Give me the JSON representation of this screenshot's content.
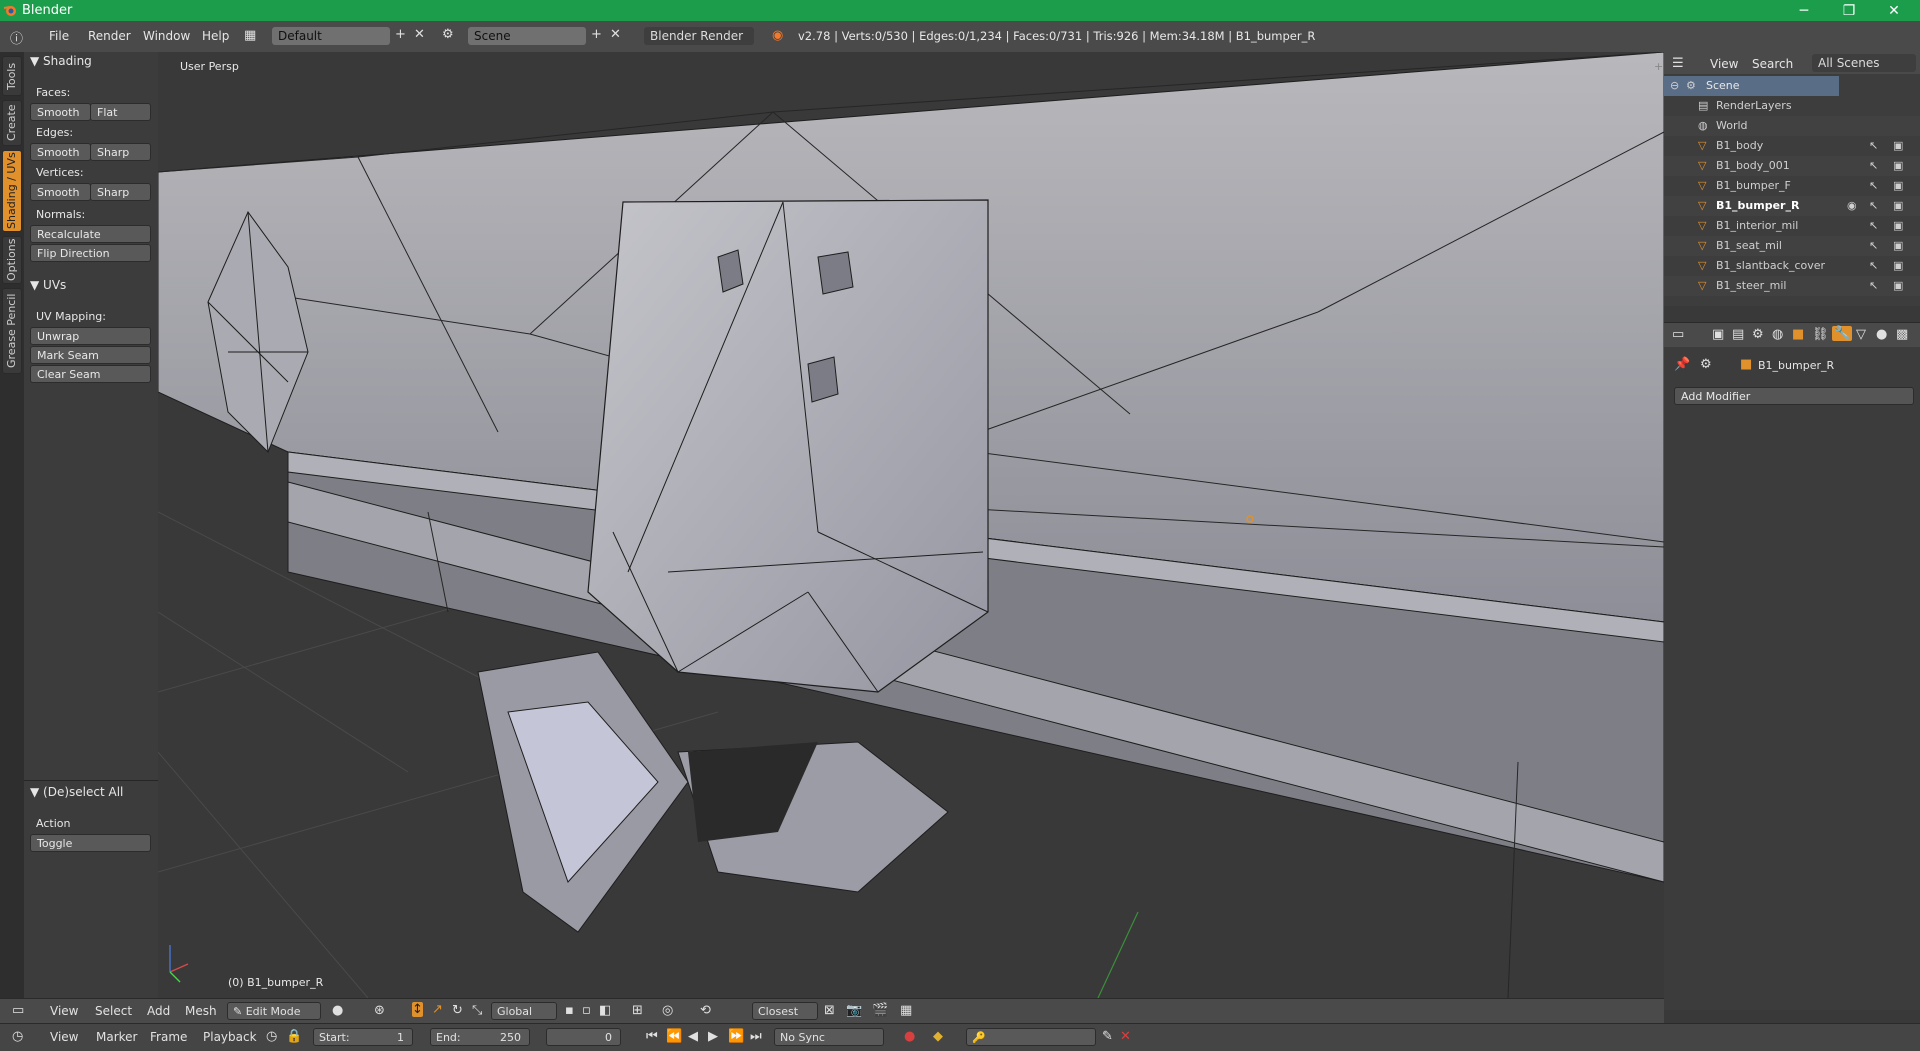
{
  "window": {
    "title": "Blender",
    "buttons": [
      "minimize-icon",
      "restore-icon",
      "close-icon"
    ]
  },
  "info_header": {
    "menus": [
      "File",
      "Render",
      "Window",
      "Help"
    ],
    "layout_name": "Default",
    "scene_name": "Scene",
    "render_engine": "Blender Render",
    "stats": "v2.78 | Verts:0/530 | Edges:0/1,234 | Faces:0/731 | Tris:926 | Mem:34.18M | B1_bumper_R"
  },
  "toolshelf": {
    "tabs": [
      "Tools",
      "Create",
      "Shading / UVs",
      "Options",
      "Grease Pencil"
    ],
    "active_tab": "Shading / UVs",
    "shading": {
      "title": "Shading",
      "faces_label": "Faces:",
      "faces_buttons": [
        "Smooth",
        "Flat"
      ],
      "edges_label": "Edges:",
      "edges_buttons": [
        "Smooth",
        "Sharp"
      ],
      "vertices_label": "Vertices:",
      "vertices_buttons": [
        "Smooth",
        "Sharp"
      ],
      "normals_label": "Normals:",
      "normals_buttons": [
        "Recalculate",
        "Flip Direction"
      ]
    },
    "uvs": {
      "title": "UVs",
      "mapping_label": "UV Mapping:",
      "unwrap": "Unwrap",
      "mark_seam": "Mark Seam",
      "clear_seam": "Clear Seam"
    },
    "operator": {
      "title": "(De)select All",
      "action_label": "Action",
      "action_value": "Toggle"
    }
  },
  "viewport": {
    "view_label": "User Persp",
    "object_label": "(0) B1_bumper_R"
  },
  "outliner": {
    "header_menus": [
      "View",
      "Search"
    ],
    "scope": "All Scenes",
    "items": [
      {
        "name": "Scene",
        "kind": "scene"
      },
      {
        "name": "RenderLayers",
        "kind": "renderlayers"
      },
      {
        "name": "World",
        "kind": "world"
      },
      {
        "name": "B1_body",
        "kind": "mesh"
      },
      {
        "name": "B1_body_001",
        "kind": "mesh"
      },
      {
        "name": "B1_bumper_F",
        "kind": "mesh"
      },
      {
        "name": "B1_bumper_R",
        "kind": "mesh",
        "selected": true
      },
      {
        "name": "B1_interior_mil",
        "kind": "mesh"
      },
      {
        "name": "B1_seat_mil",
        "kind": "mesh"
      },
      {
        "name": "B1_slantback_cover",
        "kind": "mesh"
      },
      {
        "name": "B1_steer_mil",
        "kind": "mesh"
      }
    ]
  },
  "properties": {
    "object_name": "B1_bumper_R",
    "add_modifier": "Add Modifier"
  },
  "view3d_header": {
    "menus": [
      "View",
      "Select",
      "Add",
      "Mesh"
    ],
    "mode": "Edit Mode",
    "orientation": "Global",
    "snap_target": "Closest"
  },
  "timeline": {
    "menus": [
      "View",
      "Marker",
      "Frame",
      "Playback"
    ],
    "start_label": "Start:",
    "start_value": "1",
    "end_label": "End:",
    "end_value": "250",
    "current_frame": "0",
    "sync": "No Sync"
  },
  "colors": {
    "accent": "#e0912c",
    "titlebar": "#1b9d4b",
    "selected_row": "#5a6d87"
  }
}
